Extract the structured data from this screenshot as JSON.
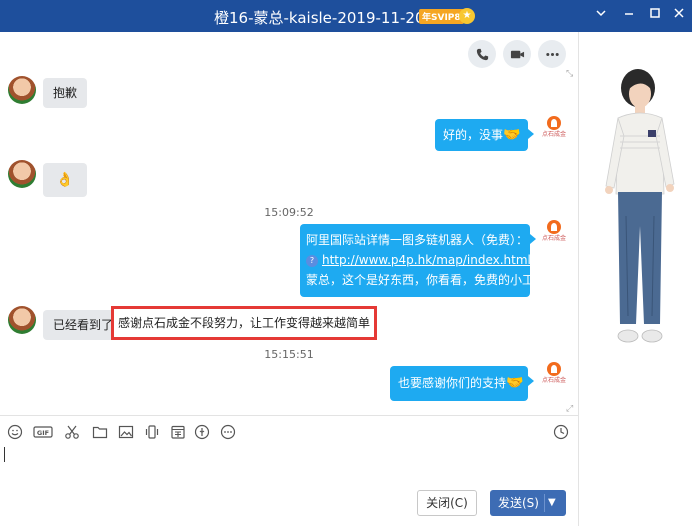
{
  "window": {
    "title": "橙16-蒙总-kaisle-2019-11-20",
    "badge": "年SVIP8",
    "controls": [
      "chevron-down-icon",
      "minimize-icon",
      "maximize-icon",
      "close-icon"
    ]
  },
  "chat_header": {
    "buttons": [
      "phone-icon",
      "video-icon",
      "more-icon"
    ]
  },
  "messages": [
    {
      "side": "left",
      "text": "抱歉"
    },
    {
      "side": "right",
      "text": "好的，没事",
      "emoji": "🤝"
    },
    {
      "side": "left",
      "emoji": "👌"
    },
    {
      "timestamp": "15:09:52"
    },
    {
      "side": "right",
      "line1": "阿里国际站详情一图多链机器人（免费）：",
      "link": "http://www.p4p.hk/map/index.html",
      "line3": "蒙总，这个是好东西，你看看，免费的小工具"
    },
    {
      "side": "left",
      "text": "已经看到了",
      "highlight": "感谢点石成金不段努力，让工作变得越来越简单"
    },
    {
      "timestamp": "15:15:51"
    },
    {
      "side": "right",
      "text": "也要感谢你们的支持",
      "emoji": "🤝"
    }
  ],
  "brand_logo_text": "点石成金",
  "toolbar": {
    "icons": [
      "emoji-icon",
      "gif-icon",
      "scissors-icon",
      "folder-icon",
      "image-icon",
      "shake-icon",
      "calendar-icon",
      "red-packet-icon",
      "more-circle-icon",
      "history-clock-icon"
    ],
    "gif_label": "GIF"
  },
  "input": {
    "value": ""
  },
  "buttons": {
    "close": "关闭(C)",
    "send": "发送(S)"
  },
  "colors": {
    "titlebar": "#1e4f9c",
    "bubble_right": "#1eaaf1",
    "bubble_left": "#e6e8eb",
    "highlight_border": "#e53935",
    "send_button": "#3d6cb4"
  }
}
